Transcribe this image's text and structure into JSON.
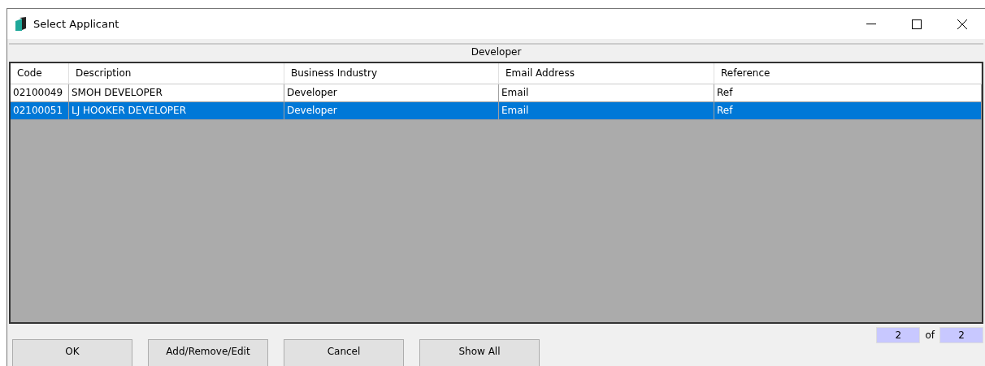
{
  "window": {
    "title": "Select Applicant"
  },
  "group_header": "Developer",
  "table": {
    "columns": [
      "Code",
      "Description",
      "Business Industry",
      "Email Address",
      "Reference"
    ],
    "rows": [
      {
        "cells": [
          "02100049",
          "SMOH DEVELOPER",
          "Developer",
          "Email",
          "Ref"
        ],
        "selected": false
      },
      {
        "cells": [
          "02100051",
          "LJ HOOKER DEVELOPER",
          "Developer",
          "Email",
          "Ref"
        ],
        "selected": true
      }
    ]
  },
  "buttons": [
    "OK",
    "Add/Remove/Edit",
    "Cancel",
    "Show All"
  ],
  "pager": {
    "current": "2",
    "of": "of",
    "total": "2"
  }
}
